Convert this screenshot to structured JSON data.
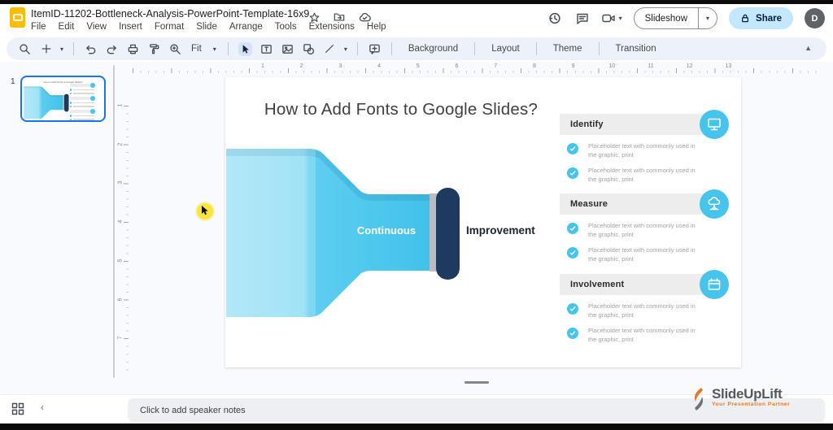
{
  "topbar": {
    "title": "ItemID-11202-Bottleneck-Analysis-PowerPoint-Template-16x9",
    "menus": [
      "File",
      "Edit",
      "View",
      "Insert",
      "Format",
      "Slide",
      "Arrange",
      "Tools",
      "Extensions",
      "Help"
    ],
    "slideshow_label": "Slideshow",
    "share_label": "Share",
    "avatar_letter": "D"
  },
  "toolbar": {
    "fit_label": "Fit",
    "text_buttons": [
      "Background",
      "Layout",
      "Theme",
      "Transition"
    ]
  },
  "filmstrip": {
    "slide_number": "1"
  },
  "rulers": {
    "horizontal": [
      "1",
      "2",
      "3",
      "4",
      "5",
      "6",
      "7",
      "8",
      "9",
      "10",
      "11",
      "12",
      "13"
    ],
    "vertical": [
      "1",
      "2",
      "3",
      "4",
      "5",
      "6",
      "7"
    ]
  },
  "slide": {
    "title": "How to Add Fonts to Google Slides?",
    "funnel": {
      "inner_label": "Continuous",
      "outer_label": "Improvement"
    },
    "placeholder_line1": "Placeholder text with commonly used in",
    "placeholder_line2": "the graphic, print",
    "sections": [
      {
        "heading": "Identify",
        "icon": "monitor-icon"
      },
      {
        "heading": "Measure",
        "icon": "cloud-icon"
      },
      {
        "heading": "Involvement",
        "icon": "calendar-icon"
      }
    ]
  },
  "notes": {
    "placeholder": "Click to add speaker notes"
  },
  "watermark": {
    "brand": "SlideUpLift",
    "tagline": "Your Presentation Partner"
  },
  "colors": {
    "selection_blue": "#1a73e8",
    "toolbar_pill": "#edf2fa",
    "share_pill": "#c2e7ff",
    "slides_yellow": "#fbbc04",
    "funnel_blue": "#41c2ea",
    "funnel_light": "#9fe3f7",
    "cap_navy": "#1e3a60",
    "section_icon_blue": "#47c4ec",
    "logo_orange": "#e87724"
  }
}
